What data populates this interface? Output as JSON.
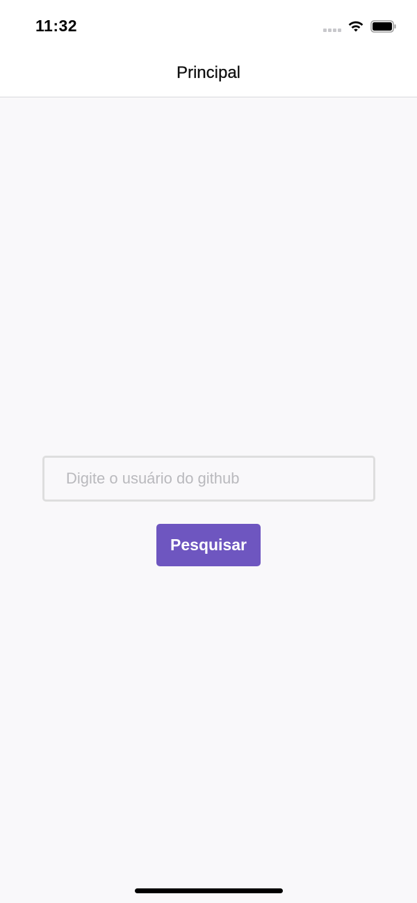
{
  "status_bar": {
    "time": "11:32",
    "icons": [
      "signal-icon",
      "wifi-icon",
      "battery-icon"
    ]
  },
  "nav": {
    "title": "Principal"
  },
  "search": {
    "value": "",
    "placeholder": "Digite o usuário do github"
  },
  "actions": {
    "search_label": "Pesquisar"
  },
  "colors": {
    "accent": "#6e56c0",
    "background": "#f9f8fa",
    "input_border": "#dedede",
    "placeholder": "#b9b9bd"
  }
}
